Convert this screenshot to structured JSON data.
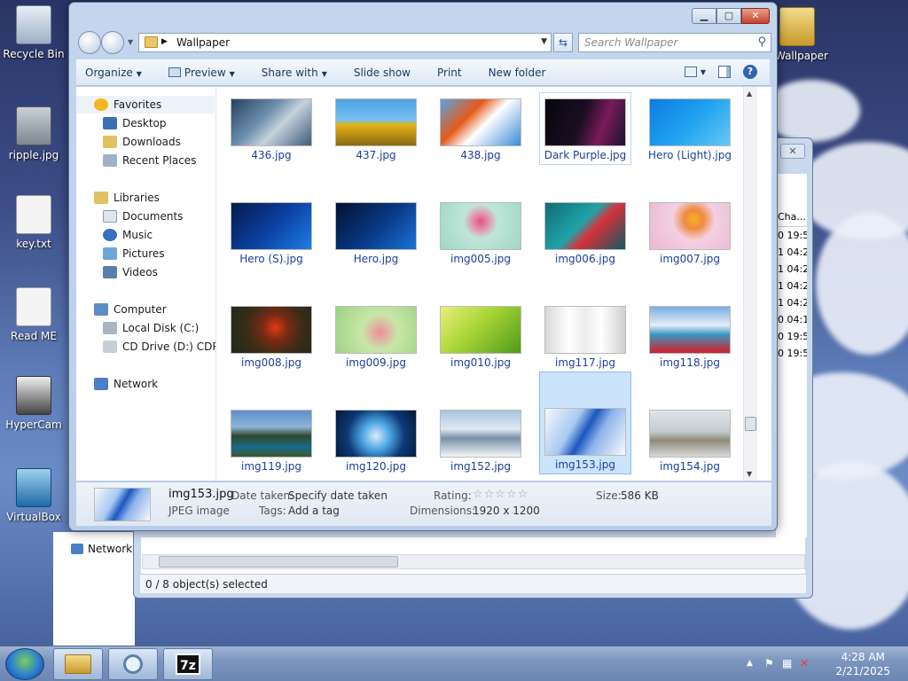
{
  "desktop": {
    "icons": [
      {
        "label": "Recycle Bin"
      },
      {
        "label": "ripple.jpg"
      },
      {
        "label": "key.txt"
      },
      {
        "label": "Read ME"
      },
      {
        "label": "HyperCam"
      },
      {
        "label": "VirtualBox"
      },
      {
        "label": "Wallpaper"
      }
    ]
  },
  "background_window": {
    "column_header": "Cha...",
    "rows": [
      "0 19:5",
      "1 04:2",
      "1 04:2",
      "1 04:2",
      "1 04:2",
      "0 04:1",
      "0 19:5",
      "0 19:5"
    ],
    "nav_item": "Network",
    "status": "0 / 8 object(s) selected"
  },
  "window": {
    "address": {
      "folder": "Wallpaper"
    },
    "search": {
      "placeholder": "Search Wallpaper"
    },
    "toolbar": {
      "organize": "Organize",
      "preview": "Preview",
      "share_with": "Share with",
      "slide_show": "Slide show",
      "print": "Print",
      "new_folder": "New folder"
    },
    "nav": {
      "favorites": "Favorites",
      "desktop": "Desktop",
      "downloads": "Downloads",
      "recent_places": "Recent Places",
      "libraries": "Libraries",
      "documents": "Documents",
      "music": "Music",
      "pictures": "Pictures",
      "videos": "Videos",
      "computer": "Computer",
      "local_disk": "Local Disk (C:)",
      "cd_drive": "CD Drive (D:) CDROM",
      "network": "Network"
    },
    "files": [
      {
        "name": "436.jpg",
        "bg": "linear-gradient(135deg,#27415f 0%,#6e8fae 40%,#c6d2dc 60%,#3e5a78 100%)"
      },
      {
        "name": "437.jpg",
        "bg": "linear-gradient(180deg,#4aa3e6 0%,#78c0f0 45%,#e3b316 55%,#8a6a10 100%)"
      },
      {
        "name": "438.jpg",
        "bg": "linear-gradient(135deg,#57a4e4 0%,#e45a1c 35%,#ffffff 55%,#3a8ad6 100%)"
      },
      {
        "name": "Dark Purple.jpg",
        "bg": "linear-gradient(110deg,#07060c 0%,#1a0e22 45%,#7a1b5a 70%,#1b1230 100%)"
      },
      {
        "name": "Hero (Light).jpg",
        "bg": "linear-gradient(135deg,#0e7be0 0%,#1ea2f0 50%,#66c8f8 100%)"
      },
      {
        "name": "Hero (S).jpg",
        "bg": "linear-gradient(135deg,#061a4a 0%,#0b3ea0 50%,#1d7ee6 100%)"
      },
      {
        "name": "Hero.jpg",
        "bg": "linear-gradient(135deg,#03112e 0%,#0a3a8a 55%,#1b74d8 100%)"
      },
      {
        "name": "img005.jpg",
        "bg": "radial-gradient(circle at 50% 40%,#e0508a 0%,#e68aa8 15%,#bfe6d8 35%,#9fd6c8 100%)"
      },
      {
        "name": "img006.jpg",
        "bg": "linear-gradient(135deg,#0f6b74 0%,#1fa3a8 45%,#d8303a 60%,#0c5a64 100%)"
      },
      {
        "name": "img007.jpg",
        "bg": "radial-gradient(circle at 55% 35%,#f3b320 0%,#f08a40 18%,#f3d0e2 40%,#eab7d0 100%)"
      },
      {
        "name": "img008.jpg",
        "bg": "radial-gradient(circle at 55% 45%,#e23a12 0%,#7a2a14 25%,#3a2c18 55%,#1e2a1a 100%)"
      },
      {
        "name": "img009.jpg",
        "bg": "radial-gradient(circle at 55% 55%,#f08a9a 0%,#c8e6a8 35%,#9ed283 100%)"
      },
      {
        "name": "img010.jpg",
        "bg": "linear-gradient(135deg,#e8f07a 0%,#a8d436 45%,#4f9a1a 100%)"
      },
      {
        "name": "img117.jpg",
        "bg": "linear-gradient(90deg,#d8d8d8 0%,#ffffff 30%,#ececec 50%,#ffffff 70%,#cfcfcf 100%)"
      },
      {
        "name": "img118.jpg",
        "bg": "linear-gradient(180deg,#79aee0 0%,#e3eef8 40%,#3b96c4 60%,#d21d2a 100%)"
      },
      {
        "name": "img119.jpg",
        "bg": "linear-gradient(180deg,#5e8fc8 0%,#8fb4d8 35%,#2f4a2a 55%,#1a6a8a 80%,#3c5a2a 100%)"
      },
      {
        "name": "img120.jpg",
        "bg": "radial-gradient(circle at 50% 55%,#d9ecfa 0%,#4aa4e0 30%,#0d3a78 60%,#041838 100%)"
      },
      {
        "name": "img152.jpg",
        "bg": "linear-gradient(180deg,#a8c4e0 0%,#dfe8f0 40%,#7890a8 60%,#f4f6f8 100%)"
      },
      {
        "name": "img153.jpg",
        "bg": "linear-gradient(120deg,#f5f9fd 0%,#a9c9f1 35%,#1c57c0 50%,#8fb4ea 65%,#f8fbff 100%)"
      },
      {
        "name": "img154.jpg",
        "bg": "linear-gradient(180deg,#dfe6ea 0%,#c4ccd0 45%,#8f8a7a 65%,#d8dadc 100%)"
      }
    ],
    "details": {
      "filename": "img153.jpg",
      "type": "JPEG image",
      "date_taken_label": "Date taken:",
      "date_taken_value": "Specify date taken",
      "tags_label": "Tags:",
      "tags_value": "Add a tag",
      "rating_label": "Rating:",
      "rating_stars": "☆☆☆☆☆",
      "dimensions_label": "Dimensions:",
      "dimensions_value": "1920 x 1200",
      "size_label": "Size:",
      "size_value": "586 KB"
    }
  },
  "taskbar": {
    "time": "4:28 AM",
    "date": "2/21/2025",
    "sevenzip_label": "7z"
  }
}
